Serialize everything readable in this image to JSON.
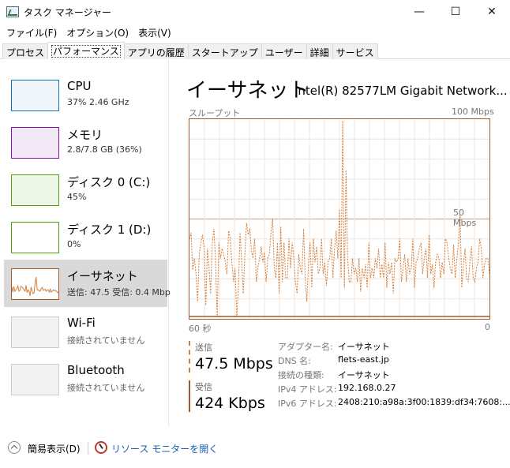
{
  "window": {
    "title": "タスク マネージャー",
    "controls": {
      "minimize": "—",
      "maximize": "☐",
      "close": "✕"
    }
  },
  "menu": [
    "ファイル(F)",
    "オプション(O)",
    "表示(V)"
  ],
  "tabs": [
    "プロセス",
    "パフォーマンス",
    "アプリの履歴",
    "スタートアップ",
    "ユーザー",
    "詳細",
    "サービス"
  ],
  "active_tab": "パフォーマンス",
  "sidebar": {
    "items": [
      {
        "name": "CPU",
        "detail": "37%  2.46 GHz",
        "color": "#1170b8",
        "fill": "#f1f6fb"
      },
      {
        "name": "メモリ",
        "detail": "2.8/7.8 GB (36%)",
        "color": "#8b12ae",
        "fill": "#f3e9f6"
      },
      {
        "name": "ディスク 0 (C:)",
        "detail": "45%",
        "color": "#4da60c",
        "fill": "#eef7e7"
      },
      {
        "name": "ディスク 1 (D:)",
        "detail": "0%",
        "color": "#4da60c",
        "fill": "#ffffff"
      },
      {
        "name": "イーサネット",
        "detail": "送信: 47.5  受信: 0.4 Mbp",
        "color": "#a45b2c",
        "fill": "#ffffff"
      },
      {
        "name": "Wi-Fi",
        "detail": "接続されていません",
        "color": "#cccccc",
        "fill": "#f2f2f2"
      },
      {
        "name": "Bluetooth",
        "detail": "接続されていません",
        "color": "#cccccc",
        "fill": "#f2f2f2"
      }
    ]
  },
  "main": {
    "title": "イーサネット",
    "adapter_name": "Intel(R) 82577LM Gigabit Network...",
    "throughput_label": "スループット",
    "max_label": "100 Mbps",
    "mid_label": "50 Mbps",
    "time_label": "60 秒",
    "zero_label": "0",
    "send_label": "送信",
    "send_value": "47.5 Mbps",
    "recv_label": "受信",
    "recv_value": "424 Kbps",
    "properties": [
      {
        "key": "アダプター名:",
        "value": "イーサネット"
      },
      {
        "key": "DNS 名:",
        "value": "flets-east.jp"
      },
      {
        "key": "接続の種類:",
        "value": "イーサネット"
      },
      {
        "key": "IPv4 アドレス:",
        "value": "192.168.0.27"
      },
      {
        "key": "IPv6 アドレス:",
        "value": "2408:210:a98a:3f00:1839:df34:7608:..."
      }
    ]
  },
  "chart_data": {
    "type": "line",
    "xlabel": "60 秒",
    "ylabel": "スループット",
    "xlim": [
      60,
      0
    ],
    "ylim": [
      0,
      100
    ],
    "y_unit": "Mbps",
    "series": [
      {
        "name": "送信",
        "color": "#d27f3c",
        "style": "dashed",
        "values": [
          40,
          43,
          24,
          30,
          22,
          8,
          32,
          38,
          42,
          35,
          6,
          35,
          25,
          12,
          38,
          45,
          29,
          0,
          38,
          30,
          35,
          32,
          28,
          22,
          44,
          40,
          28,
          18,
          25,
          0,
          15,
          43,
          28,
          12,
          32,
          48,
          42,
          45,
          34,
          30,
          40,
          18,
          25,
          30,
          36,
          28,
          33,
          18,
          30,
          32,
          43,
          50,
          25,
          20,
          38,
          12,
          46,
          18,
          38,
          20,
          20,
          40,
          25,
          38,
          30,
          18,
          12,
          32,
          25,
          22,
          45,
          20,
          8,
          28,
          38,
          15,
          40,
          28,
          36,
          22,
          25,
          40,
          22,
          28,
          16,
          28,
          30,
          40,
          20,
          35,
          44,
          30,
          55,
          20,
          100,
          15,
          75,
          30,
          18,
          18,
          30,
          22,
          25,
          18,
          30,
          13,
          25,
          20,
          27,
          15,
          38,
          20,
          25,
          20,
          30,
          25,
          35,
          20,
          27,
          20,
          38,
          15,
          28,
          22,
          28,
          12,
          30,
          28,
          30,
          40,
          18,
          25,
          32,
          18,
          30,
          22,
          25,
          40,
          15,
          28,
          30,
          35,
          38,
          22,
          30,
          35,
          20,
          42,
          22,
          27,
          15,
          28,
          32,
          30,
          20,
          28,
          22,
          40,
          38,
          30,
          25,
          22,
          37,
          20,
          30,
          38,
          52,
          15,
          27,
          35,
          20,
          18,
          28,
          36,
          20,
          18,
          25,
          28,
          40,
          35,
          20,
          27,
          30,
          30,
          22
        ]
      },
      {
        "name": "受信",
        "color": "#a45b2c",
        "style": "solid",
        "values": [
          0.4
        ]
      }
    ]
  },
  "footer": {
    "fewer_details": "簡易表示(D)",
    "resource_monitor": "リソース モニターを開く"
  }
}
